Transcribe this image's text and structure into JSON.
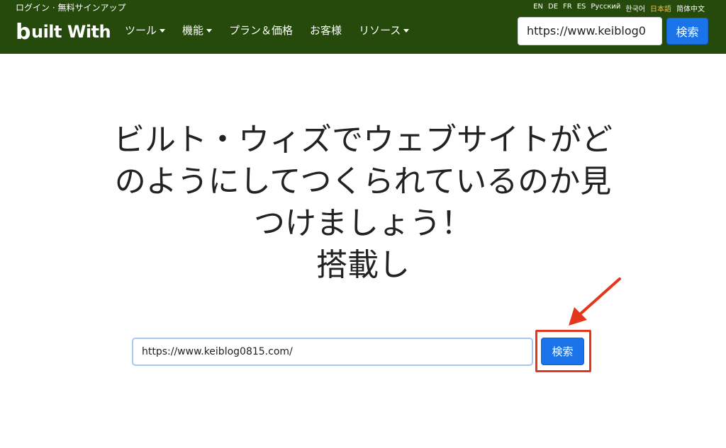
{
  "header": {
    "login_link": "ログイン · 無料サインアップ",
    "languages": [
      "EN",
      "DE",
      "FR",
      "ES",
      "Русский",
      "한국어",
      "日本語",
      "简体中文"
    ],
    "active_language": "日本語",
    "logo_text": "uilt With",
    "logo_b": "b",
    "nav": [
      {
        "label": "ツール",
        "dropdown": true
      },
      {
        "label": "機能",
        "dropdown": true
      },
      {
        "label": "プラン＆価格",
        "dropdown": false
      },
      {
        "label": "お客様",
        "dropdown": false
      },
      {
        "label": "リソース",
        "dropdown": true
      }
    ],
    "search_value": "https://www.keiblog0",
    "search_button": "検索"
  },
  "main": {
    "headline_lines": [
      "ビルト・ウィズでウェブサイトがど",
      "のようにしてつくられているのか見",
      "つけましょう！",
      "搭載し"
    ],
    "search_value": "https://www.keiblog0815.com/",
    "search_button": "検索"
  },
  "colors": {
    "header_bg": "#254a0b",
    "button_blue": "#1a73e8",
    "annotation_red": "#e3361c",
    "active_language": "#f2c14e"
  },
  "icons": {
    "dropdown": "caret-down-icon",
    "annotation": "arrow-pointer-icon"
  }
}
